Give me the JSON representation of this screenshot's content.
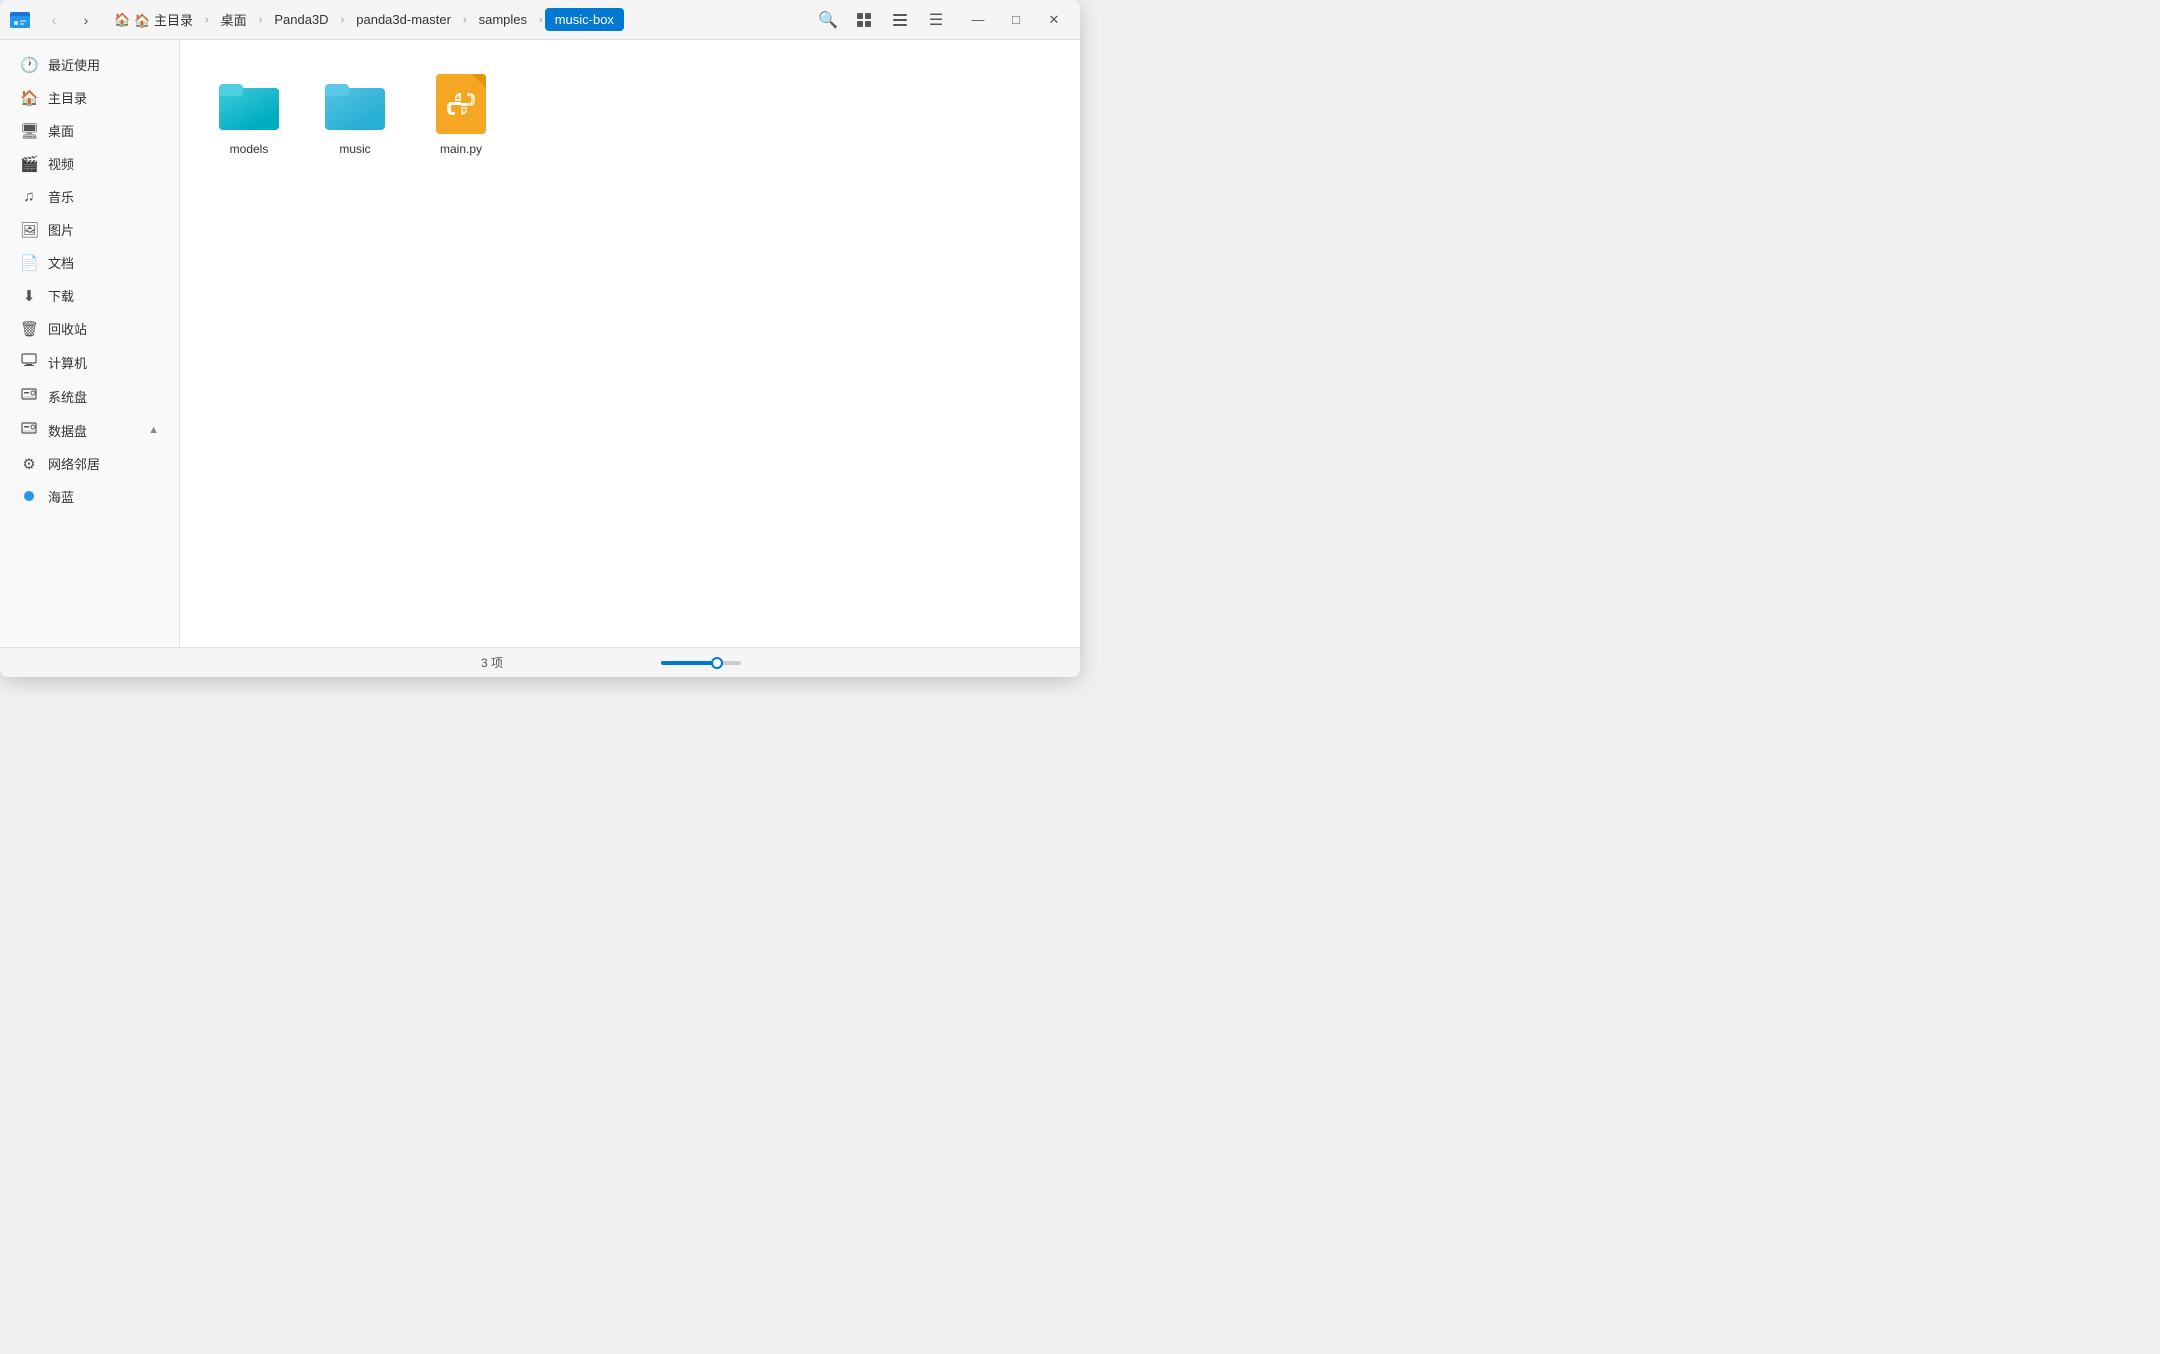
{
  "window": {
    "title": "music-box"
  },
  "titlebar": {
    "app_icon_label": "Files",
    "back_btn": "‹",
    "forward_btn": "›",
    "breadcrumb": [
      {
        "id": "home",
        "label": "🏠 主目录",
        "active": false
      },
      {
        "id": "desktop",
        "label": "桌面",
        "active": false
      },
      {
        "id": "panda3d",
        "label": "Panda3D",
        "active": false
      },
      {
        "id": "panda3d-master",
        "label": "panda3d-master",
        "active": false
      },
      {
        "id": "samples",
        "label": "samples",
        "active": false
      },
      {
        "id": "music-box",
        "label": "music-box",
        "active": true
      }
    ],
    "search_btn": "🔍",
    "grid_view_btn": "⊞",
    "list_view_btn": "≡",
    "menu_btn": "☰",
    "minimize_btn": "—",
    "maximize_btn": "□",
    "close_btn": "✕"
  },
  "sidebar": {
    "items": [
      {
        "id": "recent",
        "icon": "🕐",
        "label": "最近使用",
        "active": false
      },
      {
        "id": "home",
        "icon": "🏠",
        "label": "主目录",
        "active": false
      },
      {
        "id": "desktop",
        "icon": "🖥",
        "label": "桌面",
        "active": false
      },
      {
        "id": "videos",
        "icon": "🎬",
        "label": "视频",
        "active": false
      },
      {
        "id": "music",
        "icon": "🎵",
        "label": "音乐",
        "active": false
      },
      {
        "id": "pictures",
        "icon": "🖼",
        "label": "图片",
        "active": false
      },
      {
        "id": "documents",
        "icon": "📄",
        "label": "文档",
        "active": false
      },
      {
        "id": "downloads",
        "icon": "⬇",
        "label": "下载",
        "active": false
      },
      {
        "id": "trash",
        "icon": "🗑",
        "label": "回收站",
        "active": false
      },
      {
        "id": "computer",
        "icon": "🖥",
        "label": "计算机",
        "active": false
      },
      {
        "id": "system-disk",
        "icon": "💾",
        "label": "系统盘",
        "active": false
      },
      {
        "id": "data-disk",
        "icon": "💾",
        "label": "数据盘",
        "active": false
      },
      {
        "id": "network",
        "icon": "⚙",
        "label": "网络邻居",
        "active": false
      },
      {
        "id": "hailan",
        "icon": "dot",
        "label": "海蓝",
        "active": false,
        "dot_color": "#2196f3"
      }
    ]
  },
  "content": {
    "files": [
      {
        "id": "models",
        "type": "folder",
        "name": "models",
        "color": "teal"
      },
      {
        "id": "music",
        "type": "folder",
        "name": "music",
        "color": "cyan"
      },
      {
        "id": "main-py",
        "type": "python",
        "name": "main.py"
      }
    ]
  },
  "statusbar": {
    "item_count": "3 项",
    "zoom_percent": 70
  }
}
